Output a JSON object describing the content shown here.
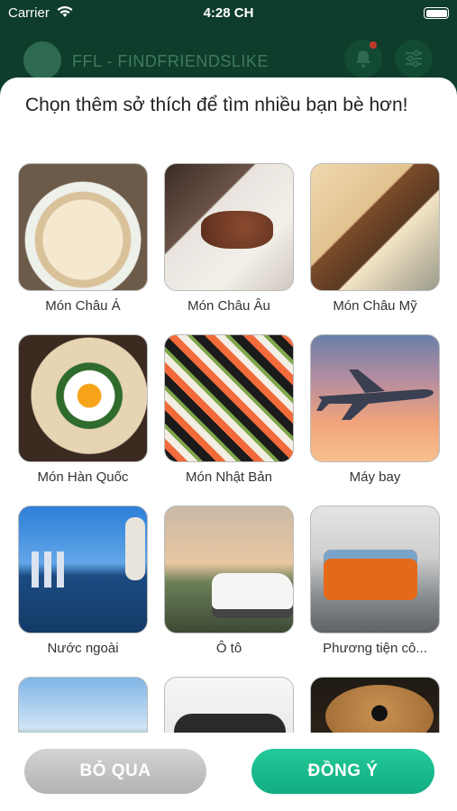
{
  "status_bar": {
    "carrier": "Carrier",
    "time": "4:28 CH"
  },
  "header": {
    "app_title": "FFL - FINDFRIENDSLIKE"
  },
  "sheet": {
    "title": "Chọn thêm sở thích để tìm nhiều bạn bè hơn!",
    "interests": [
      {
        "label": "Món Châu Á",
        "image": "pho-bowl"
      },
      {
        "label": "Món Châu Âu",
        "image": "steak-plate"
      },
      {
        "label": "Món Châu Mỹ",
        "image": "burrito"
      },
      {
        "label": "Món Hàn Quốc",
        "image": "bibimbap"
      },
      {
        "label": "Món Nhật Bản",
        "image": "sushi-platter"
      },
      {
        "label": "Máy bay",
        "image": "airplane"
      },
      {
        "label": "Nước ngoài",
        "image": "singapore-merlion"
      },
      {
        "label": "Ô tô",
        "image": "suv-car"
      },
      {
        "label": "Phương tiện cô...",
        "image": "orange-bus"
      },
      {
        "label": "",
        "image": "mountain-landscape"
      },
      {
        "label": "",
        "image": "motorcycle"
      },
      {
        "label": "",
        "image": "guitar"
      }
    ]
  },
  "footer": {
    "skip_label": "BỎ QUA",
    "agree_label": "ĐỒNG Ý"
  },
  "colors": {
    "header_bg": "#0f3d2b",
    "accent": "#15b98a",
    "skip": "#c4c4c4"
  }
}
